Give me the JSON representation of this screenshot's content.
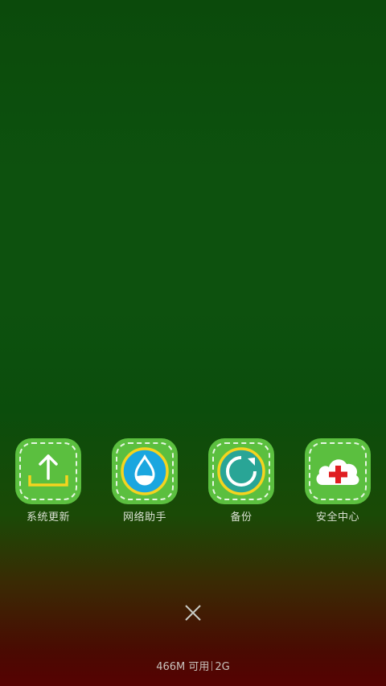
{
  "apps": [
    {
      "label": "系统更新",
      "icon": "upload-icon"
    },
    {
      "label": "网络助手",
      "icon": "water-drop-icon"
    },
    {
      "label": "备份",
      "icon": "refresh-icon"
    },
    {
      "label": "安全中心",
      "icon": "cloud-cross-icon"
    }
  ],
  "close": {
    "icon": "close-icon"
  },
  "memory": {
    "available_text": "466M 可用",
    "total_text": "2G"
  },
  "colors": {
    "icon_green": "#5bbf3f",
    "accent_yellow": "#f5d41f",
    "drop_blue": "#1aa6df",
    "cross_red": "#e01e22"
  }
}
